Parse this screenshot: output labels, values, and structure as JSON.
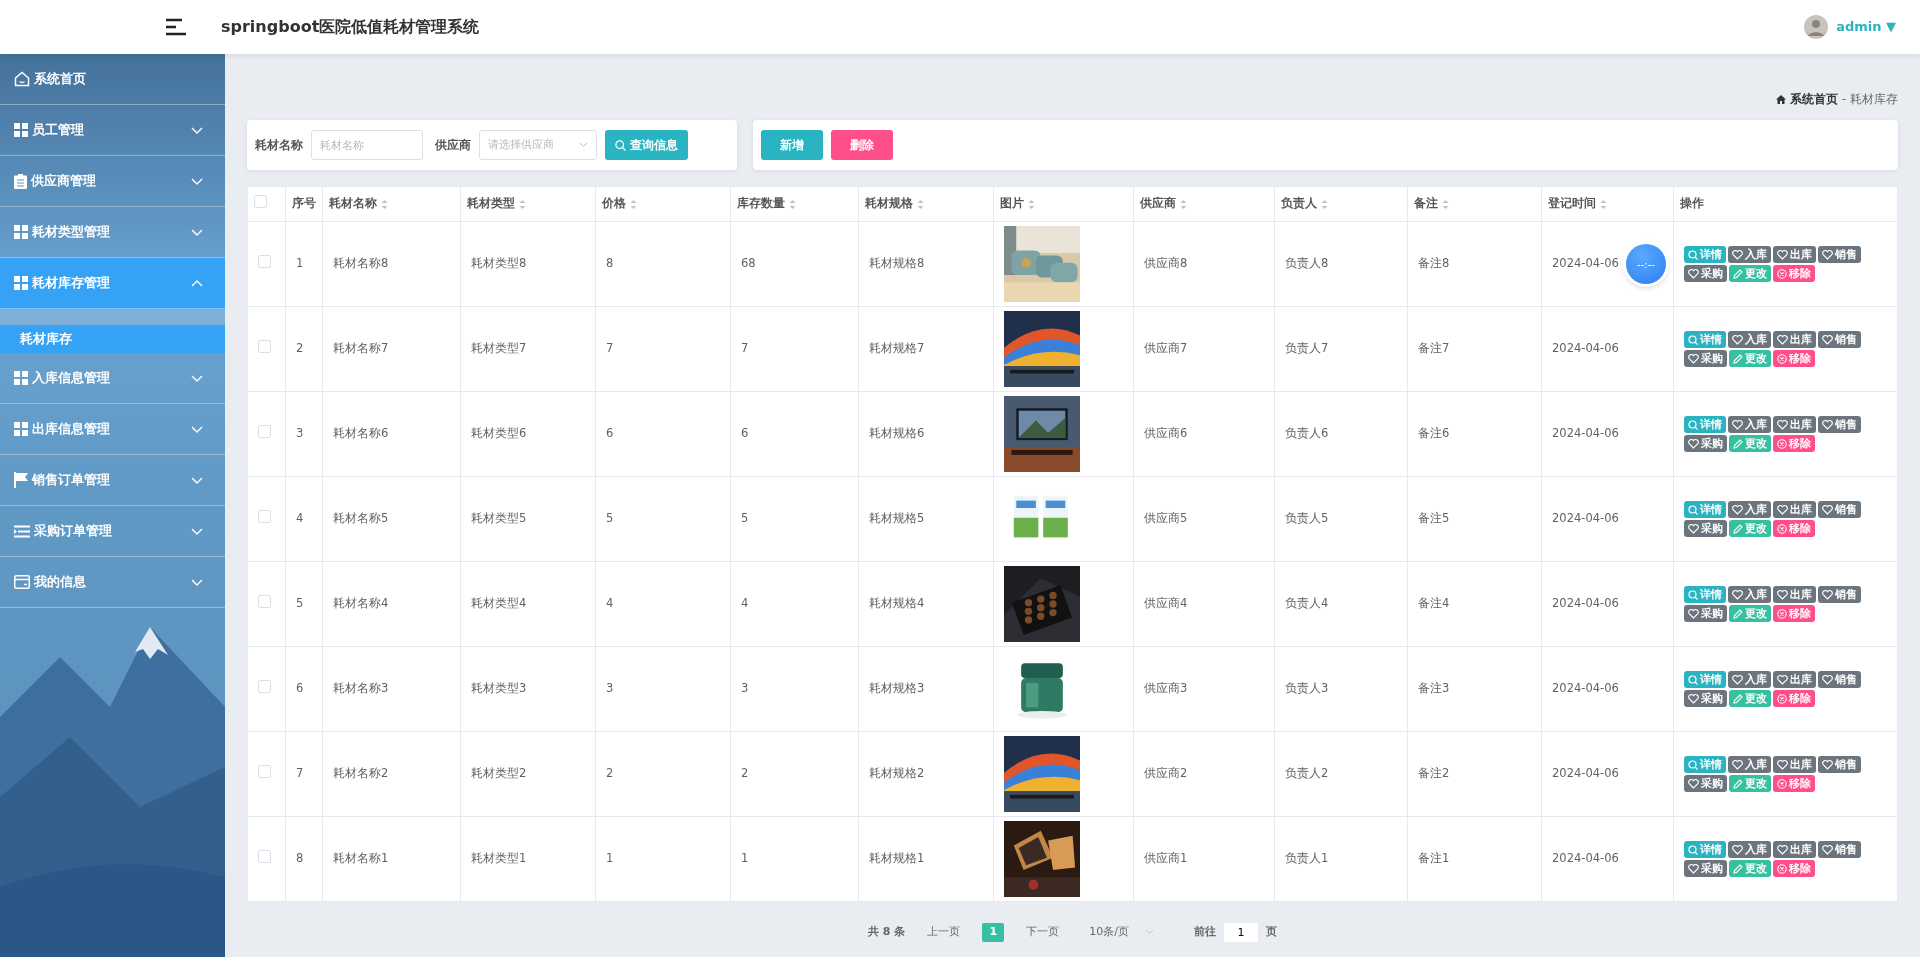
{
  "header": {
    "title": "springboot医院低值耗材管理系统",
    "user": "admin",
    "user_menu_caret": "▼"
  },
  "sidebar": {
    "items": [
      {
        "label": "系统首页",
        "kind": "home",
        "selected": false
      },
      {
        "label": "员工管理",
        "kind": "grid",
        "expanded": false,
        "selected": false
      },
      {
        "label": "供应商管理",
        "kind": "clipboard",
        "expanded": false,
        "selected": false
      },
      {
        "label": "耗材类型管理",
        "kind": "grid",
        "expanded": false,
        "selected": false
      },
      {
        "label": "耗材库存管理",
        "kind": "grid",
        "expanded": true,
        "selected": true,
        "children": [
          {
            "label": "耗材库存",
            "selected": true
          }
        ]
      },
      {
        "label": "入库信息管理",
        "kind": "grid",
        "expanded": false,
        "selected": false
      },
      {
        "label": "出库信息管理",
        "kind": "grid",
        "expanded": false,
        "selected": false
      },
      {
        "label": "销售订单管理",
        "kind": "flag",
        "expanded": false,
        "selected": false
      },
      {
        "label": "采购订单管理",
        "kind": "list",
        "expanded": false,
        "selected": false
      },
      {
        "label": "我的信息",
        "kind": "card",
        "expanded": false,
        "selected": false
      }
    ]
  },
  "breadcrumb": {
    "home": "系统首页",
    "separator": "-",
    "current": "耗材库存"
  },
  "filter": {
    "name_label": "耗材名称",
    "name_placeholder": "耗材名称",
    "supplier_label": "供应商",
    "supplier_placeholder": "请选择供应商",
    "search_button": "查询信息"
  },
  "toolbar": [
    {
      "label": "新增",
      "kind": "primary"
    },
    {
      "label": "删除",
      "kind": "danger"
    }
  ],
  "table": {
    "select_all_checked": false,
    "columns": [
      {
        "label": "序号",
        "sortable": false
      },
      {
        "label": "耗材名称",
        "sortable": true
      },
      {
        "label": "耗材类型",
        "sortable": true
      },
      {
        "label": "价格",
        "sortable": true
      },
      {
        "label": "库存数量",
        "sortable": true
      },
      {
        "label": "耗材规格",
        "sortable": true
      },
      {
        "label": "图片",
        "sortable": true
      },
      {
        "label": "供应商",
        "sortable": true
      },
      {
        "label": "负责人",
        "sortable": true
      },
      {
        "label": "备注",
        "sortable": true
      },
      {
        "label": "登记时间",
        "sortable": true
      },
      {
        "label": "操作",
        "sortable": false
      }
    ],
    "rows": [
      {
        "checked": false,
        "cells": [
          "1",
          "耗材名称8",
          "耗材类型8",
          "8",
          "68",
          "耗材规格8",
          {
            "kind": "picture"
          },
          "供应商8",
          "负责人8",
          "备注8",
          "2024-04-06"
        ],
        "timer_overlay": true,
        "timer_text": "--:--",
        "actions": [
          {
            "label": "详情",
            "kind": "search"
          },
          {
            "label": "入库",
            "kind": "heart"
          },
          {
            "label": "出库",
            "kind": "heart"
          },
          {
            "label": "销售",
            "kind": "heart"
          },
          {
            "label": "采购",
            "kind": "heart"
          },
          {
            "label": "更改",
            "kind": "edit"
          },
          {
            "label": "移除",
            "kind": "remove"
          }
        ]
      },
      {
        "checked": false,
        "cells": [
          "2",
          "耗材名称7",
          "耗材类型7",
          "7",
          "7",
          "耗材规格7",
          {
            "kind": "picture"
          },
          "供应商7",
          "负责人7",
          "备注7",
          "2024-04-06"
        ],
        "actions": [
          {
            "label": "详情",
            "kind": "search"
          },
          {
            "label": "入库",
            "kind": "heart"
          },
          {
            "label": "出库",
            "kind": "heart"
          },
          {
            "label": "销售",
            "kind": "heart"
          },
          {
            "label": "采购",
            "kind": "heart"
          },
          {
            "label": "更改",
            "kind": "edit"
          },
          {
            "label": "移除",
            "kind": "remove"
          }
        ]
      },
      {
        "checked": false,
        "cells": [
          "3",
          "耗材名称6",
          "耗材类型6",
          "6",
          "6",
          "耗材规格6",
          {
            "kind": "picture"
          },
          "供应商6",
          "负责人6",
          "备注6",
          "2024-04-06"
        ],
        "actions": [
          {
            "label": "详情",
            "kind": "search"
          },
          {
            "label": "入库",
            "kind": "heart"
          },
          {
            "label": "出库",
            "kind": "heart"
          },
          {
            "label": "销售",
            "kind": "heart"
          },
          {
            "label": "采购",
            "kind": "heart"
          },
          {
            "label": "更改",
            "kind": "edit"
          },
          {
            "label": "移除",
            "kind": "remove"
          }
        ]
      },
      {
        "checked": false,
        "cells": [
          "4",
          "耗材名称5",
          "耗材类型5",
          "5",
          "5",
          "耗材规格5",
          {
            "kind": "picture"
          },
          "供应商5",
          "负责人5",
          "备注5",
          "2024-04-06"
        ],
        "actions": [
          {
            "label": "详情",
            "kind": "search"
          },
          {
            "label": "入库",
            "kind": "heart"
          },
          {
            "label": "出库",
            "kind": "heart"
          },
          {
            "label": "销售",
            "kind": "heart"
          },
          {
            "label": "采购",
            "kind": "heart"
          },
          {
            "label": "更改",
            "kind": "edit"
          },
          {
            "label": "移除",
            "kind": "remove"
          }
        ]
      },
      {
        "checked": false,
        "cells": [
          "5",
          "耗材名称4",
          "耗材类型4",
          "4",
          "4",
          "耗材规格4",
          {
            "kind": "picture"
          },
          "供应商4",
          "负责人4",
          "备注4",
          "2024-04-06"
        ],
        "actions": [
          {
            "label": "详情",
            "kind": "search"
          },
          {
            "label": "入库",
            "kind": "heart"
          },
          {
            "label": "出库",
            "kind": "heart"
          },
          {
            "label": "销售",
            "kind": "heart"
          },
          {
            "label": "采购",
            "kind": "heart"
          },
          {
            "label": "更改",
            "kind": "edit"
          },
          {
            "label": "移除",
            "kind": "remove"
          }
        ]
      },
      {
        "checked": false,
        "cells": [
          "6",
          "耗材名称3",
          "耗材类型3",
          "3",
          "3",
          "耗材规格3",
          {
            "kind": "picture"
          },
          "供应商3",
          "负责人3",
          "备注3",
          "2024-04-06"
        ],
        "actions": [
          {
            "label": "详情",
            "kind": "search"
          },
          {
            "label": "入库",
            "kind": "heart"
          },
          {
            "label": "出库",
            "kind": "heart"
          },
          {
            "label": "销售",
            "kind": "heart"
          },
          {
            "label": "采购",
            "kind": "heart"
          },
          {
            "label": "更改",
            "kind": "edit"
          },
          {
            "label": "移除",
            "kind": "remove"
          }
        ]
      },
      {
        "checked": false,
        "cells": [
          "7",
          "耗材名称2",
          "耗材类型2",
          "2",
          "2",
          "耗材规格2",
          {
            "kind": "picture"
          },
          "供应商2",
          "负责人2",
          "备注2",
          "2024-04-06"
        ],
        "actions": [
          {
            "label": "详情",
            "kind": "search"
          },
          {
            "label": "入库",
            "kind": "heart"
          },
          {
            "label": "出库",
            "kind": "heart"
          },
          {
            "label": "销售",
            "kind": "heart"
          },
          {
            "label": "采购",
            "kind": "heart"
          },
          {
            "label": "更改",
            "kind": "edit"
          },
          {
            "label": "移除",
            "kind": "remove"
          }
        ]
      },
      {
        "checked": false,
        "cells": [
          "8",
          "耗材名称1",
          "耗材类型1",
          "1",
          "1",
          "耗材规格1",
          {
            "kind": "picture"
          },
          "供应商1",
          "负责人1",
          "备注1",
          "2024-04-06"
        ],
        "actions": [
          {
            "label": "详情",
            "kind": "search"
          },
          {
            "label": "入库",
            "kind": "heart"
          },
          {
            "label": "出库",
            "kind": "heart"
          },
          {
            "label": "销售",
            "kind": "heart"
          },
          {
            "label": "采购",
            "kind": "heart"
          },
          {
            "label": "更改",
            "kind": "edit"
          },
          {
            "label": "移除",
            "kind": "remove"
          }
        ]
      }
    ]
  },
  "pagination": {
    "total": "共 8 条",
    "prev": "上一页",
    "pages": [
      {
        "label": "1",
        "selected": true
      }
    ],
    "next": "下一页",
    "page_size": "10条/页",
    "goto_label": "前往",
    "goto_value": "1",
    "goto_suffix": "页"
  }
}
